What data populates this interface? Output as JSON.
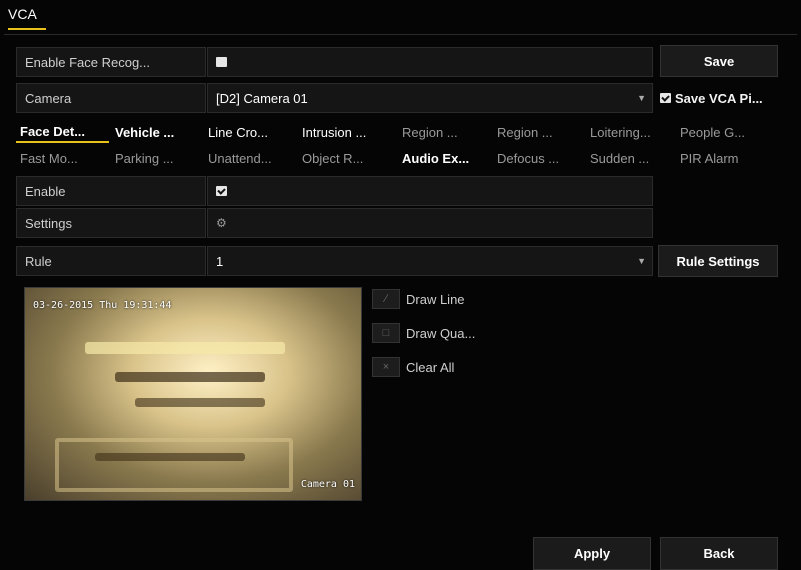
{
  "app": {
    "tab_title": "VCA"
  },
  "enable_face": {
    "label": "Enable Face Recog...",
    "checked": false
  },
  "save_button": "Save",
  "camera": {
    "label": "Camera",
    "value": "[D2] Camera 01"
  },
  "save_vca_pic": {
    "label": "Save VCA Pi...",
    "checked": true
  },
  "tabs_row1": [
    {
      "label": "Face Det...",
      "active": true
    },
    {
      "label": "Vehicle ..."
    },
    {
      "label": "Line Cro..."
    },
    {
      "label": "Intrusion ..."
    },
    {
      "label": "Region ..."
    },
    {
      "label": "Region ..."
    },
    {
      "label": "Loitering..."
    },
    {
      "label": "People G..."
    }
  ],
  "tabs_row2": [
    {
      "label": "Fast Mo..."
    },
    {
      "label": "Parking ..."
    },
    {
      "label": "Unattend..."
    },
    {
      "label": "Object R..."
    },
    {
      "label": "Audio Ex..."
    },
    {
      "label": "Defocus ..."
    },
    {
      "label": "Sudden ..."
    },
    {
      "label": "PIR Alarm"
    }
  ],
  "enable": {
    "label": "Enable",
    "checked": true
  },
  "settings": {
    "label": "Settings",
    "icon": "gear-icon"
  },
  "rule": {
    "label": "Rule",
    "value": "1"
  },
  "rule_settings_button": "Rule Settings",
  "tools": [
    {
      "label": "Draw Line",
      "icon": "draw-line-icon"
    },
    {
      "label": "Draw Qua...",
      "icon": "draw-quadrilateral-icon"
    },
    {
      "label": "Clear All",
      "icon": "clear-all-icon"
    }
  ],
  "video": {
    "timestamp": "03-26-2015 Thu 19:31:44",
    "camera_name": "Camera 01"
  },
  "apply_button": "Apply",
  "back_button": "Back"
}
